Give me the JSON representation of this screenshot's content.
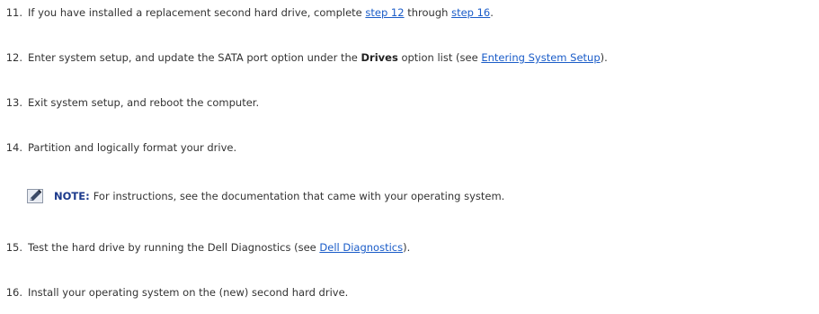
{
  "steps": [
    {
      "num": "11.",
      "pre": "If you have installed a replacement second hard drive, complete ",
      "link1": "step 12",
      "mid": " through ",
      "link2": "step 16",
      "post": "."
    },
    {
      "num": "12.",
      "pre": "Enter system setup, and update the SATA port option under the ",
      "bold": "Drives",
      "mid": " option list (see ",
      "link": "Entering System Setup",
      "post": ")."
    },
    {
      "num": "13.",
      "text": "Exit system setup, and reboot the computer."
    },
    {
      "num": "14.",
      "text": "Partition and logically format your drive."
    },
    {
      "num": "15.",
      "pre": "Test the hard drive by running the Dell Diagnostics (see ",
      "link": "Dell Diagnostics",
      "post": ")."
    },
    {
      "num": "16.",
      "text": "Install your operating system on the (new) second hard drive."
    }
  ],
  "note": {
    "icon": "pencil-note-icon",
    "label": "NOTE:",
    "text": "For instructions, see the documentation that came with your operating system."
  },
  "colors": {
    "link": "#1a5cc8",
    "note_label": "#1c3a8c",
    "text": "#333333"
  }
}
